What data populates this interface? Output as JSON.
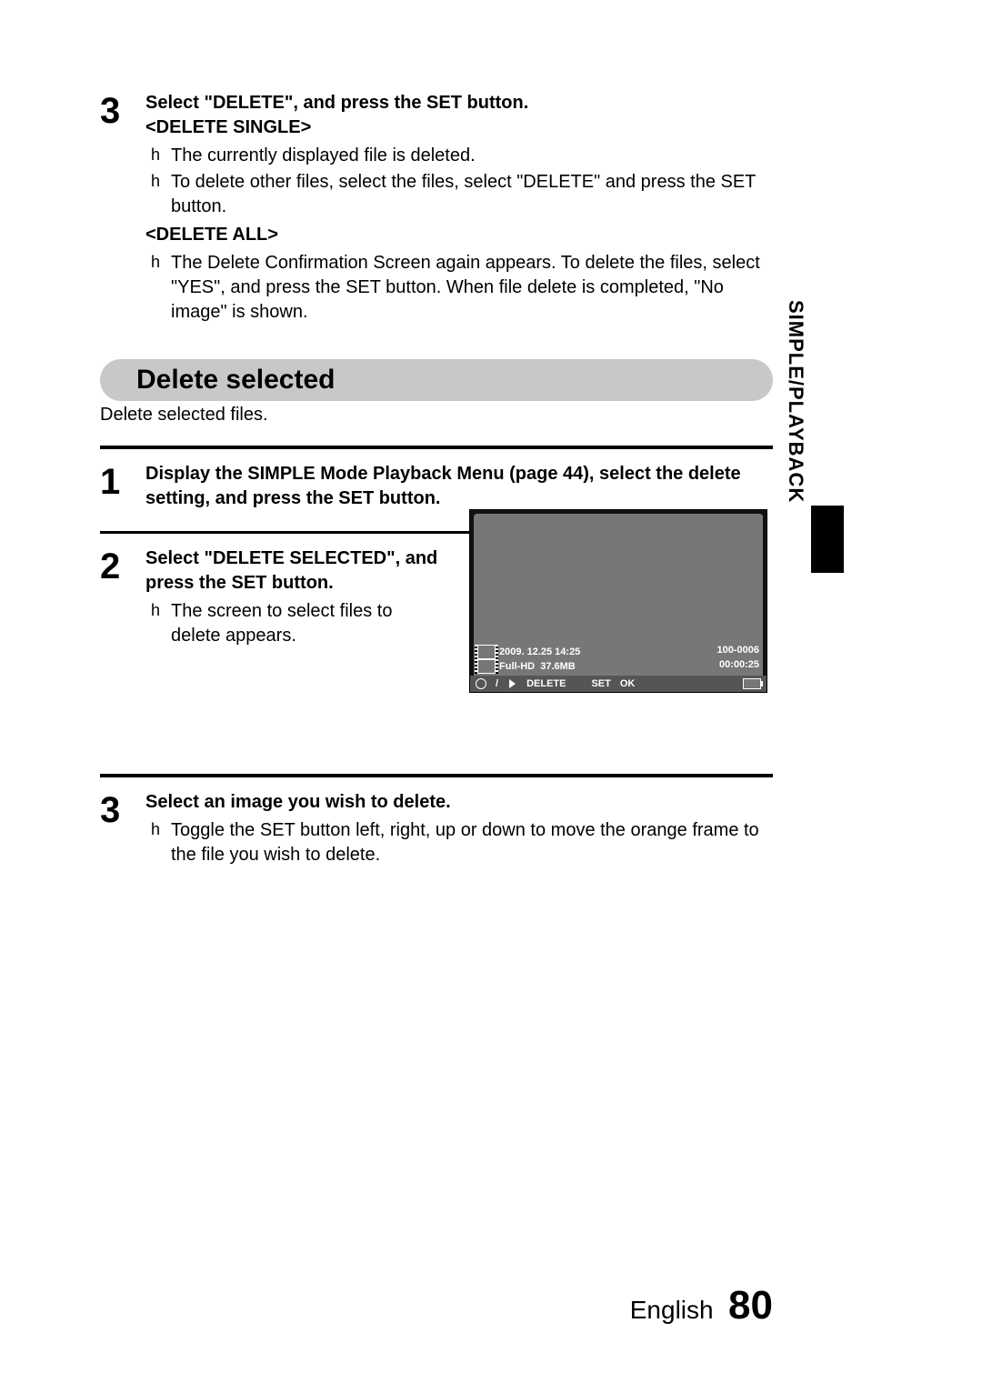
{
  "sideTab": "SIMPLE/PLAYBACK",
  "step3top": {
    "num": "3",
    "heading": "Select \"DELETE\", and press the SET button.",
    "sub1": "<DELETE SINGLE>",
    "b1": "The currently displayed file is deleted.",
    "b2": "To delete other files, select the files, select \"DELETE\" and press the SET button.",
    "sub2": "<DELETE ALL>",
    "b3": "The Delete Confirmation Screen again appears. To delete the files, select \"YES\", and press the SET button. When file delete is completed, \"No image\" is shown."
  },
  "sectionTitle": "Delete selected",
  "sectionDesc": "Delete selected files.",
  "step1": {
    "num": "1",
    "text": "Display the SIMPLE Mode Playback Menu (page 44), select the delete setting, and press the SET button."
  },
  "step2": {
    "num": "2",
    "heading": "Select \"DELETE SELECTED\", and press the SET button.",
    "b1": "The screen to select files to delete appears."
  },
  "step3": {
    "num": "3",
    "heading": "Select an image you wish to delete.",
    "b1": "Toggle the SET button left, right, up or down to move the orange frame to the file you wish to delete."
  },
  "cam": {
    "date": "2009. 12.25  14:25",
    "folder": "100-0006",
    "res": "Full-HD",
    "size": "37.6MB",
    "dur": "00:00:25",
    "bar_delete": "DELETE",
    "bar_set": "SET",
    "bar_ok": "OK",
    "slash": " / "
  },
  "footer": {
    "lang": "English",
    "page": "80"
  }
}
